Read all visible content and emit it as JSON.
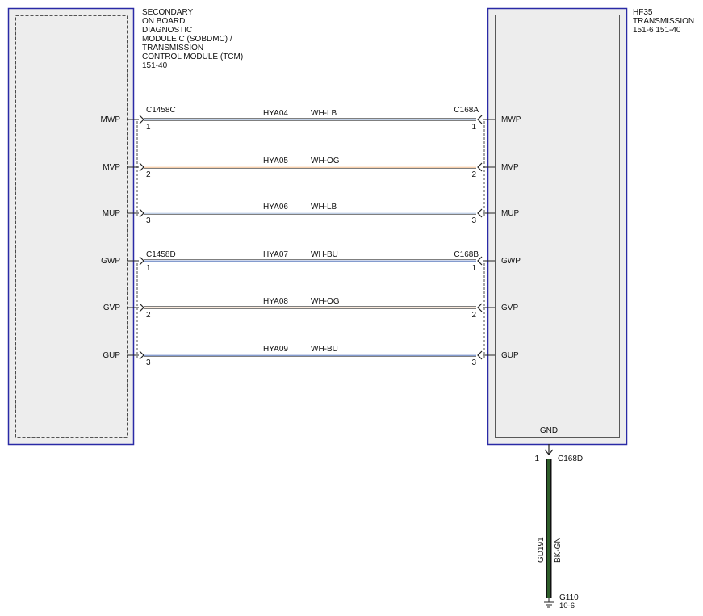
{
  "left_module": {
    "title": [
      "SECONDARY",
      "ON BOARD",
      "DIAGNOSTIC",
      "MODULE C (SOBDMC) /",
      "TRANSMISSION",
      "CONTROL MODULE (TCM)"
    ],
    "ref": "151-40"
  },
  "right_module": {
    "title": [
      "HF35",
      "TRANSMISSION"
    ],
    "ref": "151-6    151-40",
    "gnd_label": "GND"
  },
  "connectors": {
    "left_a": "C1458C",
    "left_b": "C1458D",
    "right_a": "C168A",
    "right_b": "C168B"
  },
  "circuits": [
    {
      "pin_name": "MWP",
      "pin": "1",
      "circuit": "HYA04",
      "color": "WH-LB",
      "wire_color": "#9ab4d8"
    },
    {
      "pin_name": "MVP",
      "pin": "2",
      "circuit": "HYA05",
      "color": "WH-OG",
      "wire_color": "#f0b27a"
    },
    {
      "pin_name": "MUP",
      "pin": "3",
      "circuit": "HYA06",
      "color": "WH-LB",
      "wire_color": "#9ab4d8"
    },
    {
      "pin_name": "GWP",
      "pin": "1",
      "circuit": "HYA07",
      "color": "WH-BU",
      "wire_color": "#3a5fb0"
    },
    {
      "pin_name": "GVP",
      "pin": "2",
      "circuit": "HYA08",
      "color": "WH-OG",
      "wire_color": "#f0b27a"
    },
    {
      "pin_name": "GUP",
      "pin": "3",
      "circuit": "HYA09",
      "color": "WH-BU",
      "wire_color": "#3a5fb0"
    }
  ],
  "ground": {
    "pin": "1",
    "connector": "C168D",
    "circuit": "GD191",
    "color": "BK-GN",
    "point": "G110",
    "point_ref": "10-6",
    "wire_color": "#2e5e2a"
  },
  "colors": {
    "module_border": "#2a2aa6",
    "module_fill": "#ededed",
    "wire_outline": "#555555"
  }
}
